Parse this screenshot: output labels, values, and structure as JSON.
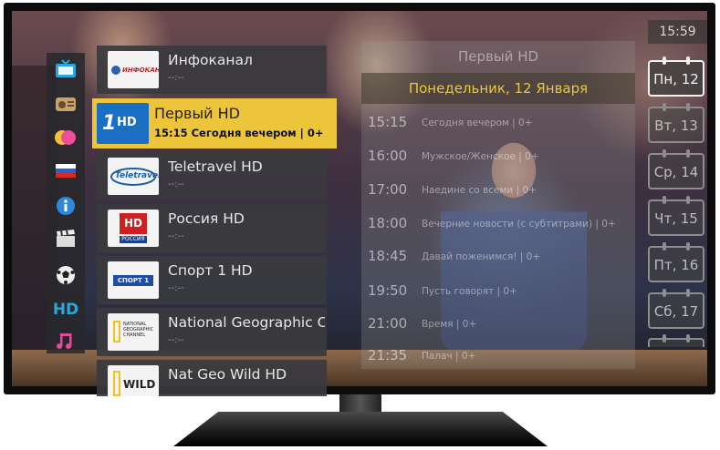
{
  "clock": "15:59",
  "sidebar_icons": [
    {
      "name": "tv-icon",
      "color": "#2aa6d8"
    },
    {
      "name": "radio-icon",
      "color": "#c9a36b"
    },
    {
      "name": "favorites-icon",
      "color": "#ef4f9a"
    },
    {
      "name": "russia-flag-icon",
      "color": "#d52b1e"
    },
    {
      "name": "info-icon",
      "color": "#2d8ad8"
    },
    {
      "name": "film-icon",
      "color": "#dddddd"
    },
    {
      "name": "football-icon",
      "color": "#eeeeee"
    },
    {
      "name": "hd-icon",
      "label": "HD",
      "color": "#2aa6d8"
    },
    {
      "name": "music-icon",
      "color": "#e04b9b"
    }
  ],
  "channels": [
    {
      "name": "Инфоканал",
      "program": "--:--",
      "logo_text": "ИНФОКАНАЛ",
      "selected": false
    },
    {
      "name": "Первый HD",
      "program": "15:15 Сегодня вечером | 0+",
      "logo_text": "HD",
      "selected": true
    },
    {
      "name": "Teletravel HD",
      "program": "--:--",
      "logo_text": "Teletravel",
      "selected": false
    },
    {
      "name": "Россия HD",
      "program": "--:--",
      "logo_text": "HD",
      "logo_subtext": "РОССИЯ",
      "selected": false
    },
    {
      "name": "Спорт 1 HD",
      "program": "--:--",
      "logo_text": "СПОРТ 1",
      "selected": false
    },
    {
      "name": "National Geographic Ch",
      "program": "--:--",
      "logo_text": "NATIONAL GEOGRAPHIC CHANNEL",
      "selected": false
    },
    {
      "name": "Nat Geo Wild HD",
      "program": "",
      "logo_text": "WILD",
      "selected": false
    }
  ],
  "epg": {
    "channel_title": "Первый HD",
    "date": "Понедельник, 12 Января",
    "programs": [
      {
        "time": "15:15",
        "title": "Сегодня вечером | 0+"
      },
      {
        "time": "16:00",
        "title": "Мужское/Женское | 0+"
      },
      {
        "time": "17:00",
        "title": "Наедине со всеми | 0+"
      },
      {
        "time": "18:00",
        "title": "Вечерние новости (с субтитрами) | 0+"
      },
      {
        "time": "18:45",
        "title": "Давай поженимся! | 0+"
      },
      {
        "time": "19:50",
        "title": "Пусть говорят | 0+"
      },
      {
        "time": "21:00",
        "title": "Время | 0+"
      },
      {
        "time": "21:35",
        "title": "Палач | 0+"
      }
    ]
  },
  "days": [
    {
      "label": "Пн, 12",
      "active": true
    },
    {
      "label": "Вт, 13",
      "active": false
    },
    {
      "label": "Ср, 14",
      "active": false
    },
    {
      "label": "Чт, 15",
      "active": false
    },
    {
      "label": "Пт, 16",
      "active": false
    },
    {
      "label": "Сб, 17",
      "active": false
    }
  ],
  "colors": {
    "accent": "#ecc53a",
    "date_text": "#e9c63b",
    "panel": "#3a3a3e"
  }
}
